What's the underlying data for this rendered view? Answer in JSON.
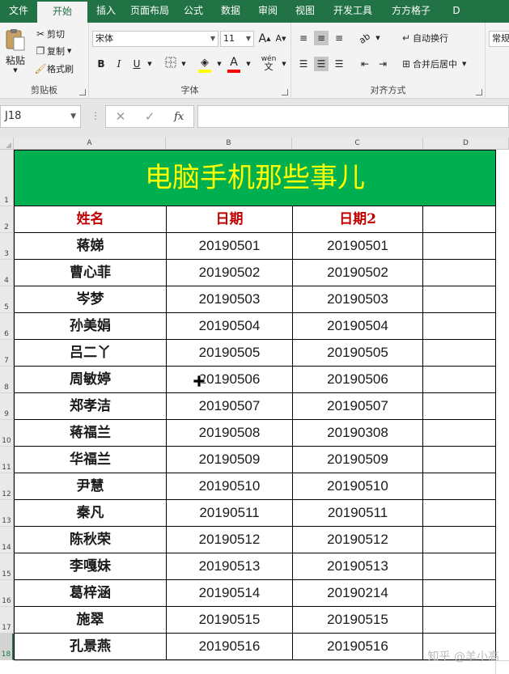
{
  "tabs": [
    "文件",
    "开始",
    "插入",
    "页面布局",
    "公式",
    "数据",
    "审阅",
    "视图",
    "开发工具",
    "方方格子",
    "D"
  ],
  "active_tab": "开始",
  "ribbon": {
    "clipboard": {
      "paste": "粘贴",
      "cut": "剪切",
      "copy": "复制",
      "format_painter": "格式刷",
      "label": "剪贴板"
    },
    "font": {
      "name": "宋体",
      "size": "11",
      "bold": "B",
      "italic": "I",
      "underline": "U",
      "wen": "wén",
      "label": "字体",
      "grow": "A",
      "shrink": "A"
    },
    "alignment": {
      "wrap": "自动换行",
      "merge": "合并后居中",
      "label": "对齐方式"
    },
    "number": {
      "format": "常规"
    },
    "colors": {
      "fill": "#ffff00",
      "font_color": "#ff0000"
    }
  },
  "formula_bar": {
    "name_box": "J18",
    "fx": "fx",
    "cancel": "✕",
    "enter": "✓",
    "value": ""
  },
  "columns": [
    "A",
    "B",
    "C",
    "D"
  ],
  "rows": [
    "1",
    "2",
    "3",
    "4",
    "5",
    "6",
    "7",
    "8",
    "9",
    "10",
    "11",
    "12",
    "13",
    "14",
    "15",
    "16",
    "17",
    "18"
  ],
  "selected_row": "18",
  "title": "电脑手机那些事儿",
  "header": {
    "name": "姓名",
    "date": "日期",
    "date2": "日期2"
  },
  "records": [
    {
      "name": "蒋娣",
      "date": "20190501",
      "date2": "20190501"
    },
    {
      "name": "曹心菲",
      "date": "20190502",
      "date2": "20190502"
    },
    {
      "name": "岑梦",
      "date": "20190503",
      "date2": "20190503"
    },
    {
      "name": "孙美娟",
      "date": "20190504",
      "date2": "20190504"
    },
    {
      "name": "吕二丫",
      "date": "20190505",
      "date2": "20190505"
    },
    {
      "name": "周敏婷",
      "date": "20190506",
      "date2": "20190506"
    },
    {
      "name": "郑孝洁",
      "date": "20190507",
      "date2": "20190507"
    },
    {
      "name": "蒋福兰",
      "date": "20190508",
      "date2": "20190308"
    },
    {
      "name": "华福兰",
      "date": "20190509",
      "date2": "20190509"
    },
    {
      "name": "尹慧",
      "date": "20190510",
      "date2": "20190510"
    },
    {
      "name": "秦凡",
      "date": "20190511",
      "date2": "20190511"
    },
    {
      "name": "陈秋荣",
      "date": "20190512",
      "date2": "20190512"
    },
    {
      "name": "李嘎妹",
      "date": "20190513",
      "date2": "20190513"
    },
    {
      "name": "葛梓涵",
      "date": "20190514",
      "date2": "20190214"
    },
    {
      "name": "施翠",
      "date": "20190515",
      "date2": "20190515"
    },
    {
      "name": "孔景燕",
      "date": "20190516",
      "date2": "20190516"
    }
  ],
  "watermark": "知乎 @羊小高"
}
